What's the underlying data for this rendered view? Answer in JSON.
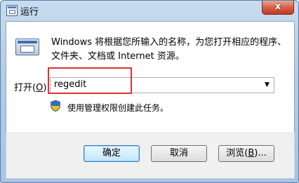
{
  "window": {
    "title": "运行",
    "close_label": "x"
  },
  "dialog": {
    "description_line1": "Windows 将根据您所输入的名称，为您打开相应的程序、",
    "description_line2": "文件夹、文档或 Internet 资源。",
    "open_label_prefix": "打开(",
    "open_label_access": "O",
    "open_label_suffix": "):",
    "open_value": "regedit",
    "admin_note": "使用管理权限创建此任务。"
  },
  "buttons": {
    "ok": "确定",
    "cancel": "取消",
    "browse_prefix": "浏览(",
    "browse_access": "B",
    "browse_suffix": ")..."
  },
  "colors": {
    "highlight": "#e03030",
    "accent": "#3c7fb1"
  }
}
